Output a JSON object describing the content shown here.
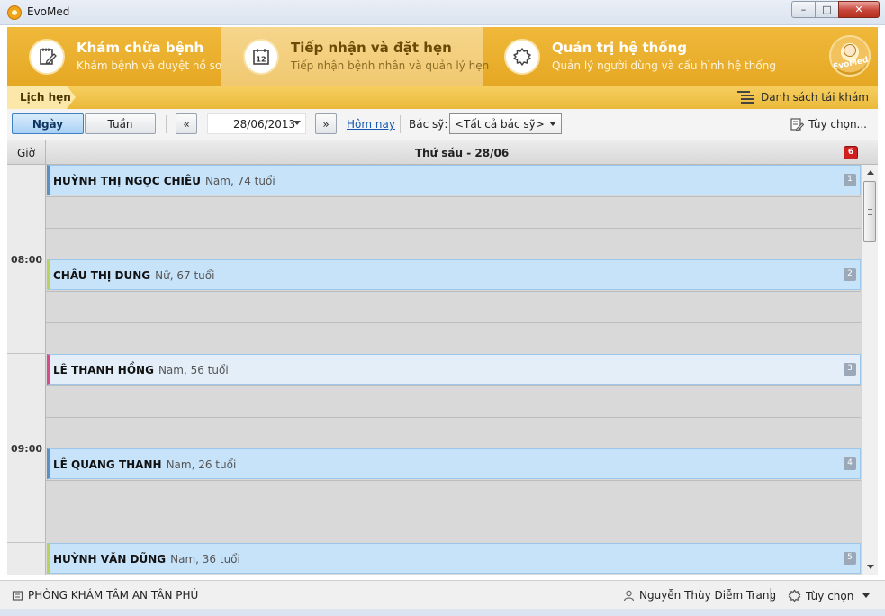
{
  "window": {
    "title": "EvoMed",
    "minimize_glyph": "–",
    "maximize_glyph": "□",
    "close_glyph": "✕"
  },
  "modules": [
    {
      "title": "Khám chữa bệnh",
      "subtitle": "Khám bệnh và duyệt hồ sơ",
      "icon": "notepad-icon"
    },
    {
      "title": "Tiếp nhận và đặt hẹn",
      "subtitle": "Tiếp nhận bệnh nhân và quản lý hẹn",
      "icon": "calendar-icon",
      "calendar_day": "12"
    },
    {
      "title": "Quản trị hệ thống",
      "subtitle": "Quản lý người dùng và cấu hình hệ thống",
      "icon": "gear-icon"
    }
  ],
  "logo": {
    "text": "EvoMed"
  },
  "breadcrumb": {
    "current": "Lịch hẹn",
    "right_action": "Danh sách tái khám"
  },
  "toolbar": {
    "day": "Ngày",
    "week": "Tuần",
    "prev": "«",
    "date": "28/06/2013",
    "next": "»",
    "today": "Hôm nay",
    "doctor_label": "Bác sỹ:",
    "doctor_value": "<Tất cả bác sỹ>",
    "options": "Tùy chọn..."
  },
  "schedule": {
    "hour_header": "Giờ",
    "day_header": "Thứ sáu - 28/06",
    "count": "6",
    "hours": [
      "08:00",
      "09:00"
    ],
    "appointments": [
      {
        "name": "HUỲNH THỊ NGỌC CHIÊU",
        "info": "Nam, 74 tuổi",
        "num": "1",
        "accent": "#5b90c6"
      },
      {
        "name": "CHÂU THỊ DUNG",
        "info": "Nữ, 67 tuổi",
        "num": "2",
        "accent": "#b9d35a"
      },
      {
        "name": "LÊ THANH HỒNG",
        "info": "Nam, 56 tuổi",
        "num": "3",
        "accent": "#d94b87"
      },
      {
        "name": "LÊ QUANG THANH",
        "info": "Nam, 26 tuổi",
        "num": "4",
        "accent": "#5b90c6"
      },
      {
        "name": "HUỲNH VĂN DŨNG",
        "info": "Nam, 36 tuổi",
        "num": "5",
        "accent": "#b9d35a"
      }
    ]
  },
  "status": {
    "clinic": "PHÒNG KHÁM TÂM AN TÂN PHÚ",
    "user": "Nguyễn Thùy Diễm Trang",
    "options": "Tùy chọn"
  },
  "colors": {
    "header_gold": "#e5a824",
    "active_module": "#f6d68c",
    "appointment_blue": "#c7e3fa"
  }
}
